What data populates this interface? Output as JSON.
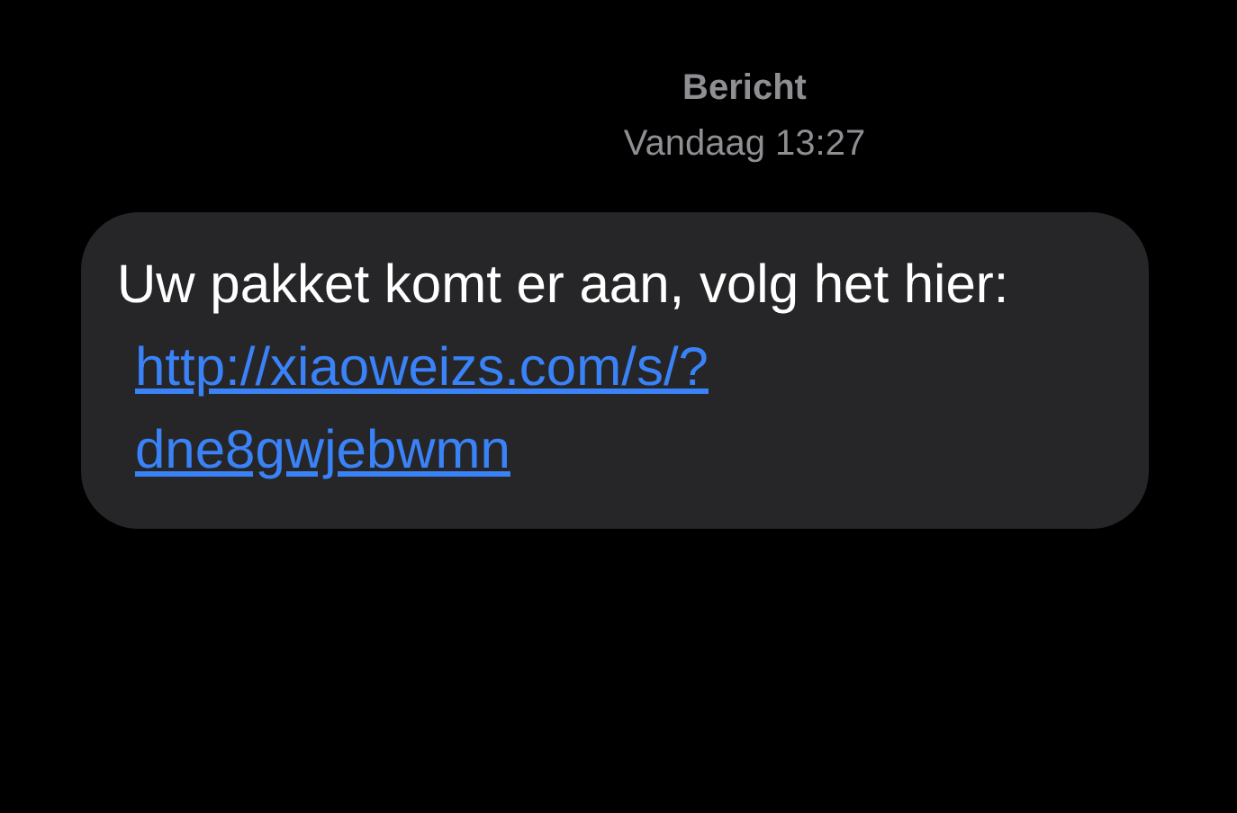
{
  "header": {
    "title": "Bericht",
    "timestamp": "Vandaag 13:27"
  },
  "message": {
    "text": "Uw pakket komt er aan, volg het hier:",
    "link": "http://xiaoweizs.com/s/?dne8gwjebwmn"
  }
}
